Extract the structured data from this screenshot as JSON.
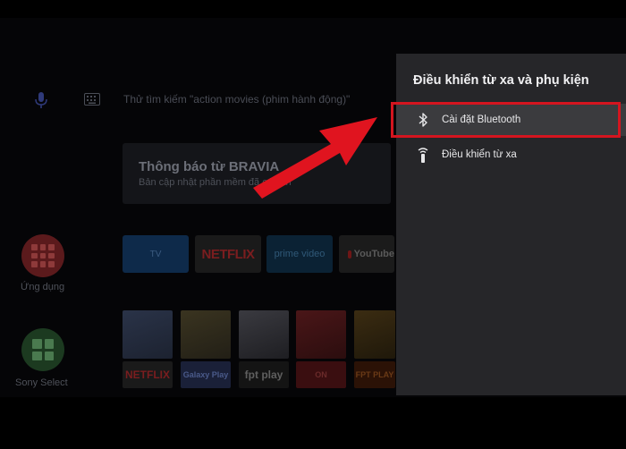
{
  "home": {
    "search_hint": "Thử tìm kiếm \"action movies (phim hành động)\"",
    "notice_title": "Thông báo từ BRAVIA",
    "notice_subtitle": "Bản cập nhật phần mềm đã có sẵn",
    "apps_label": "Ứng dụng",
    "sony_select_label": "Sony Select",
    "tiles": {
      "tv": "TV",
      "netflix": "NETFLIX",
      "prime": "prime video",
      "youtube": "YouTube"
    },
    "row2": {
      "netflix": "NETFLIX",
      "galaxy": "Galaxy Play",
      "fptplay": "fpt play",
      "on": "ON",
      "other": "FPT PLAY"
    }
  },
  "panel": {
    "title": "Điều khiển từ xa và phụ kiện",
    "items": [
      {
        "label": "Cài đặt Bluetooth",
        "icon": "bluetooth-icon",
        "selected": true
      },
      {
        "label": "Điều khiển từ xa",
        "icon": "remote-icon",
        "selected": false
      }
    ]
  },
  "annotation": {
    "highlight_color": "#d4151f",
    "arrow_color": "#e0141f"
  }
}
